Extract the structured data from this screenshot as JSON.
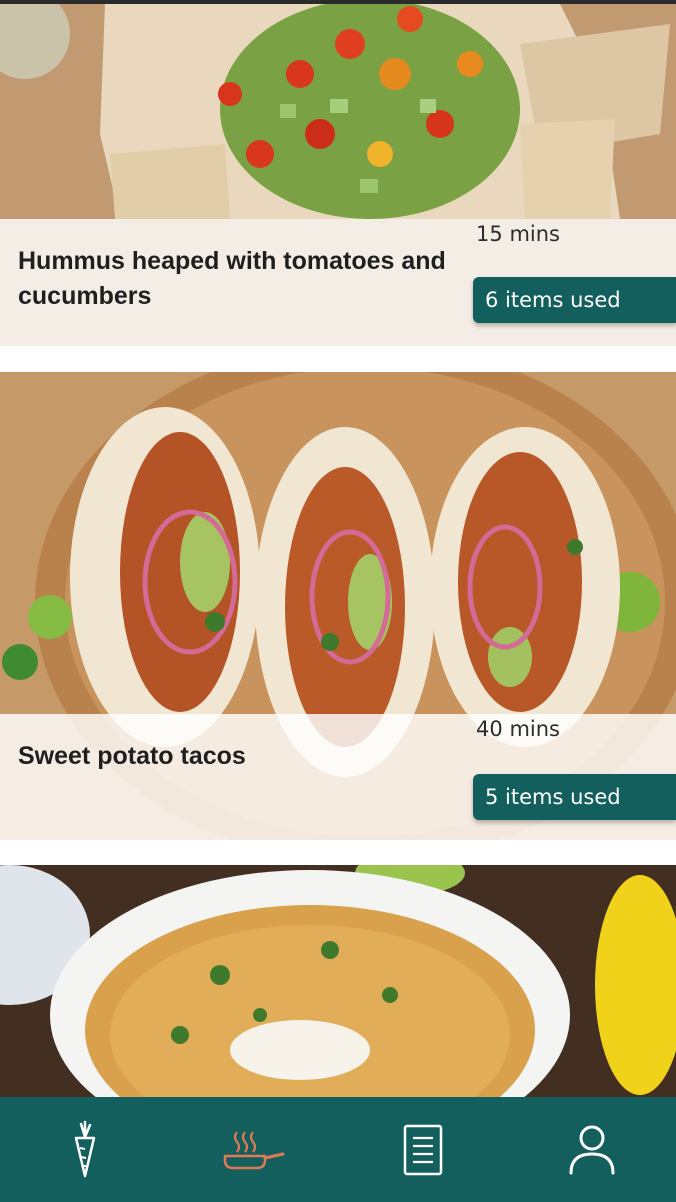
{
  "recipes": [
    {
      "title": "Hummus heaped with tomatoes and cucumbers",
      "time": "15 mins",
      "used": "6 items used"
    },
    {
      "title": "Sweet potato tacos",
      "time": "40 mins",
      "used": "5 items used"
    },
    {
      "title": "",
      "time": "",
      "used": ""
    }
  ],
  "nav": {
    "items": [
      {
        "icon": "carrot-icon"
      },
      {
        "icon": "frying-pan-icon",
        "active": true
      },
      {
        "icon": "document-icon"
      },
      {
        "icon": "user-icon"
      }
    ]
  },
  "colors": {
    "brand": "#135f5d",
    "active_icon": "#e07a55",
    "icon": "#ffffff"
  }
}
